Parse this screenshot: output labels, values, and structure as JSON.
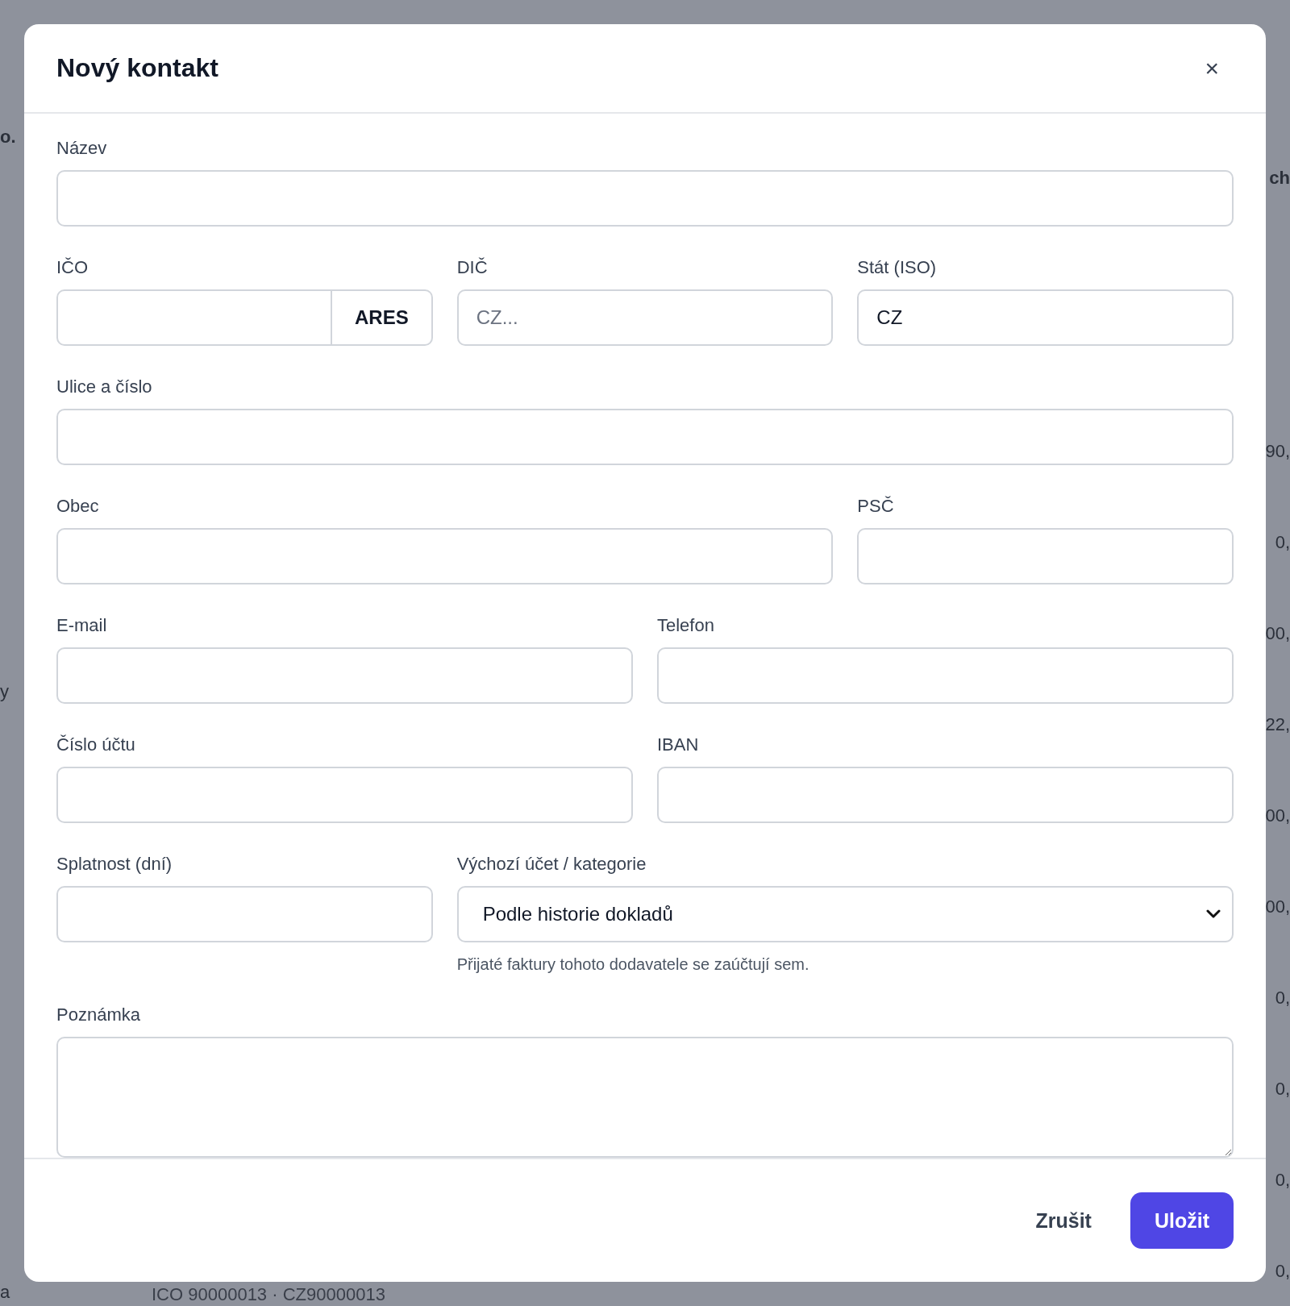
{
  "background": {
    "left_fragments": [
      "o.",
      "y",
      "a"
    ],
    "right_fragments": [
      "ch",
      "90,",
      "0,",
      "00,",
      "22,",
      "00,",
      "00,",
      "0,",
      "0,",
      "0,",
      "0,"
    ],
    "bottom_text": "ICO 90000013 · CZ90000013"
  },
  "dialog": {
    "title": "Nový kontakt",
    "close": "×",
    "rows": [
      {
        "fields": [
          {
            "kind": "text",
            "label": "Název"
          }
        ]
      },
      {
        "fields": [
          {
            "kind": "lookup",
            "label": "IČO",
            "button": "ARES"
          },
          {
            "kind": "text",
            "label": "DIČ",
            "placeholder": "CZ..."
          },
          {
            "kind": "text",
            "label": "Stát (ISO)",
            "value": "CZ"
          }
        ]
      },
      {
        "fields": [
          {
            "kind": "text",
            "label": "Ulice a číslo"
          }
        ]
      },
      {
        "fields": [
          {
            "kind": "text",
            "label": "Obec"
          },
          {
            "kind": "text",
            "label": "PSČ"
          }
        ]
      },
      {
        "fields": [
          {
            "kind": "text",
            "label": "E-mail"
          },
          {
            "kind": "text",
            "label": "Telefon"
          }
        ]
      },
      {
        "fields": [
          {
            "kind": "text",
            "label": "Číslo účtu"
          },
          {
            "kind": "text",
            "label": "IBAN"
          }
        ]
      },
      {
        "fields": [
          {
            "kind": "text",
            "label": "Splatnost (dní)"
          },
          {
            "kind": "select",
            "label": "Výchozí účet / kategorie",
            "value": "Podle historie dokladů",
            "hint": "Přijaté faktury tohoto dodavatele se zaúčtují sem."
          }
        ]
      },
      {
        "fields": [
          {
            "kind": "textarea",
            "label": "Poznámka"
          }
        ]
      }
    ],
    "buttons": [
      {
        "label": "Zrušit",
        "kind": "secondary"
      },
      {
        "label": "Uložit",
        "kind": "primary"
      }
    ]
  }
}
